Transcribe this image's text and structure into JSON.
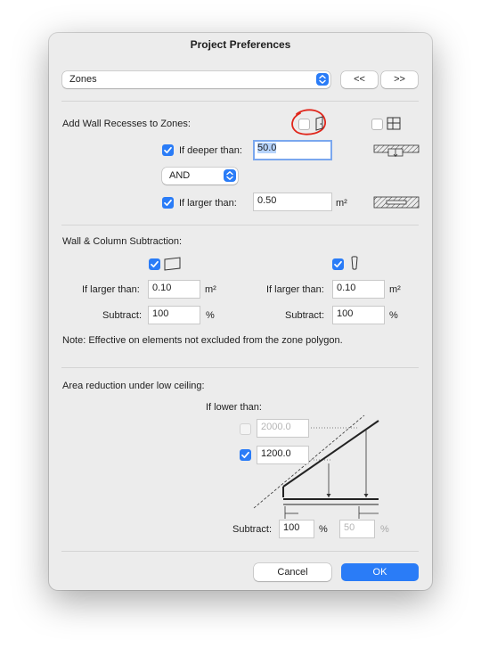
{
  "dialog": {
    "title": "Project Preferences"
  },
  "header": {
    "section_select": "Zones",
    "prev_label": "<<",
    "next_label": ">>"
  },
  "recesses": {
    "title": "Add Wall Recesses to Zones:",
    "deeper_label": "If deeper than:",
    "deeper_value": "50.0",
    "operator": "AND",
    "larger_label": "If larger than:",
    "larger_value": "0.50",
    "larger_unit": "m²"
  },
  "subtraction": {
    "title": "Wall & Column Subtraction:",
    "wall": {
      "larger_label": "If larger than:",
      "larger_value": "0.10",
      "larger_unit": "m²",
      "subtract_label": "Subtract:",
      "subtract_value": "100",
      "subtract_unit": "%"
    },
    "column": {
      "larger_label": "If larger than:",
      "larger_value": "0.10",
      "larger_unit": "m²",
      "subtract_label": "Subtract:",
      "subtract_value": "100",
      "subtract_unit": "%"
    },
    "note": "Note: Effective on elements not excluded from the zone polygon."
  },
  "ceiling": {
    "title": "Area reduction under low ceiling:",
    "lower_label": "If lower than:",
    "height1_value": "2000.0",
    "height2_value": "1200.0",
    "subtract_label": "Subtract:",
    "subtract1_value": "100",
    "subtract1_unit": "%",
    "subtract2_value": "50",
    "subtract2_unit": "%"
  },
  "footer": {
    "cancel_label": "Cancel",
    "ok_label": "OK"
  },
  "colors": {
    "accent": "#2a7cf7",
    "annotation": "#e0261b"
  }
}
